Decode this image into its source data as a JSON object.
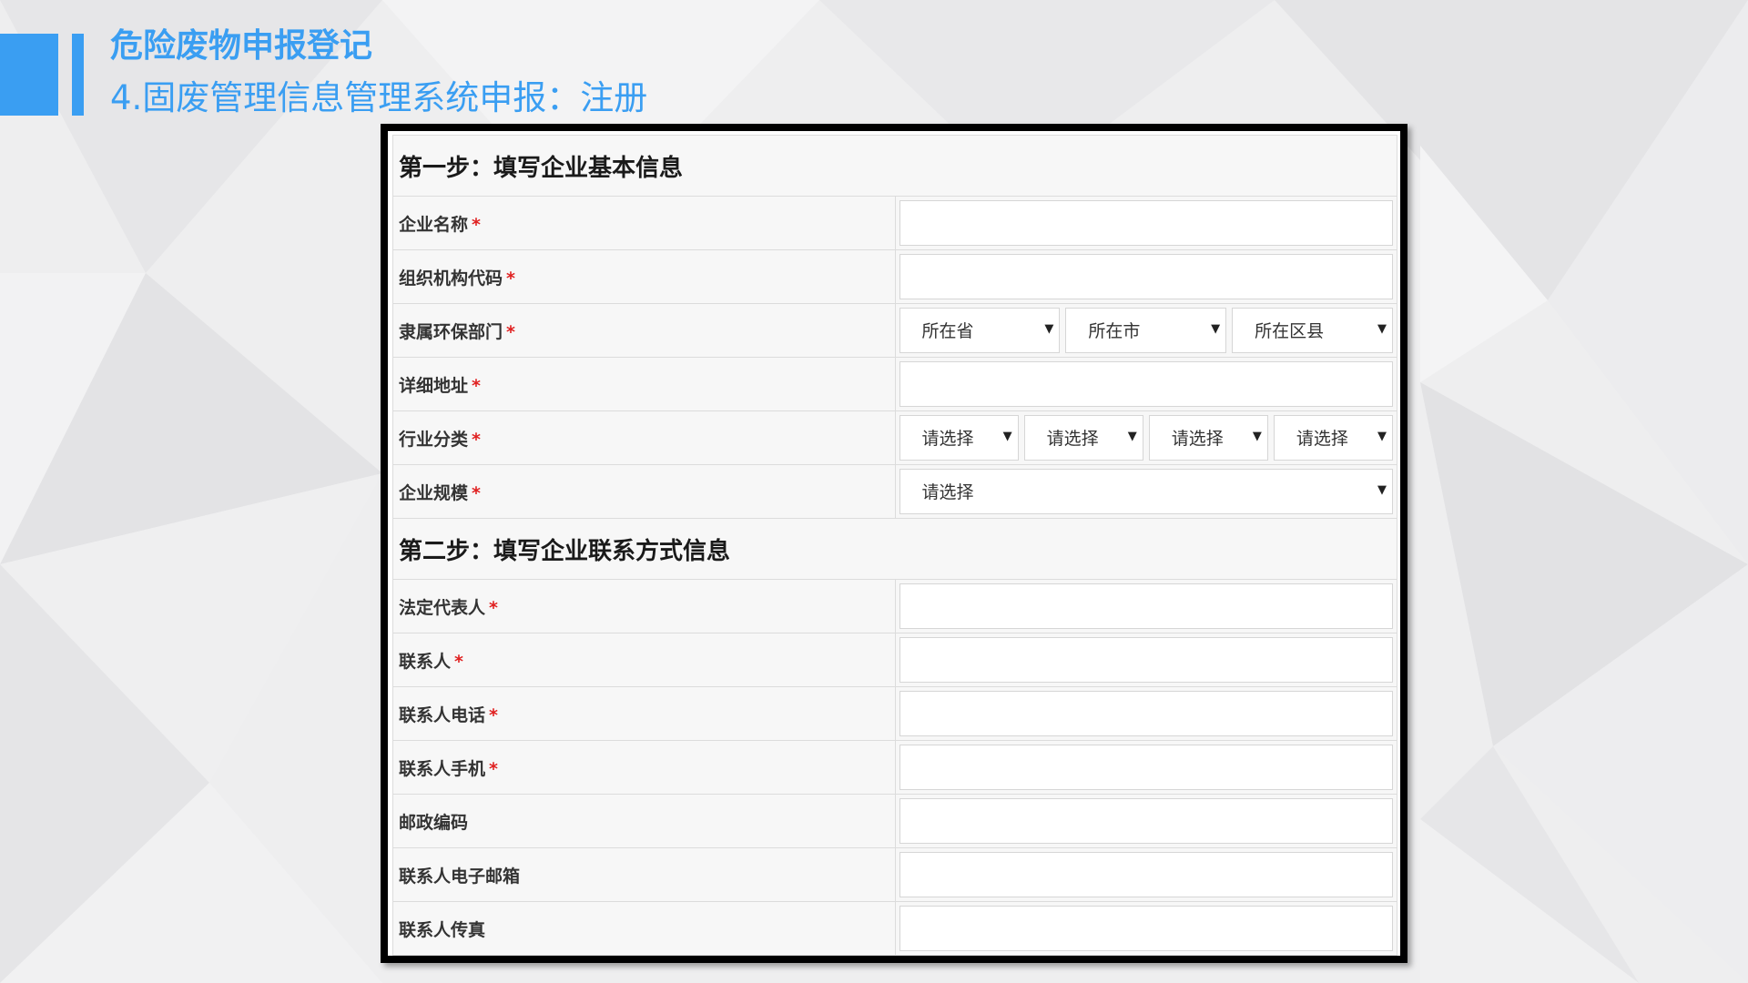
{
  "slide": {
    "title": "危险废物申报登记",
    "subtitle": "4.固废管理信息管理系统申报：注册",
    "accent_color": "#3a9ef2"
  },
  "form": {
    "required_mark": "*",
    "select_arrow": "▼",
    "step1": {
      "heading": "第一步：填写企业基本信息",
      "fields": {
        "company_name": "企业名称",
        "org_code": "组织机构代码",
        "env_dept": {
          "label": "隶属环保部门",
          "province": "所在省",
          "city": "所在市",
          "district": "所在区县"
        },
        "address": "详细地址",
        "industry": {
          "label": "行业分类",
          "options": [
            "请选择",
            "请选择",
            "请选择",
            "请选择"
          ]
        },
        "scale": {
          "label": "企业规模",
          "value": "请选择"
        }
      }
    },
    "step2": {
      "heading": "第二步：填写企业联系方式信息",
      "fields": {
        "legal_rep": "法定代表人",
        "contact": "联系人",
        "contact_phone": "联系人电话",
        "contact_mobile": "联系人手机",
        "postal_code": "邮政编码",
        "contact_email": "联系人电子邮箱",
        "contact_fax": "联系人传真"
      }
    }
  }
}
